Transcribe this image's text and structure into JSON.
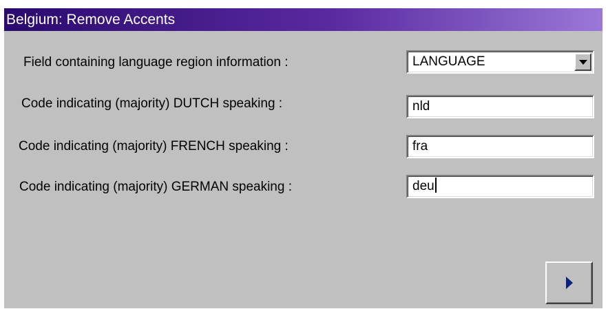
{
  "window": {
    "title": "Belgium: Remove Accents"
  },
  "form": {
    "language_field": {
      "label": "Field containing language region information :",
      "selected": "LANGUAGE"
    },
    "dutch_code": {
      "label": "Code indicating (majority) DUTCH speaking :",
      "value": "nld"
    },
    "french_code": {
      "label": "Code indicating (majority) FRENCH speaking :",
      "value": "fra"
    },
    "german_code": {
      "label": "Code indicating (majority) GERMAN speaking :",
      "value": "deu"
    }
  },
  "icons": {
    "dropdown": "chevron-down-icon",
    "next": "play-icon"
  },
  "colors": {
    "dialog_background": "#c0c0c0",
    "titlebar_start": "#2a0a6e",
    "titlebar_end": "#9a78d8",
    "next_arrow": "#0c1f7a"
  }
}
